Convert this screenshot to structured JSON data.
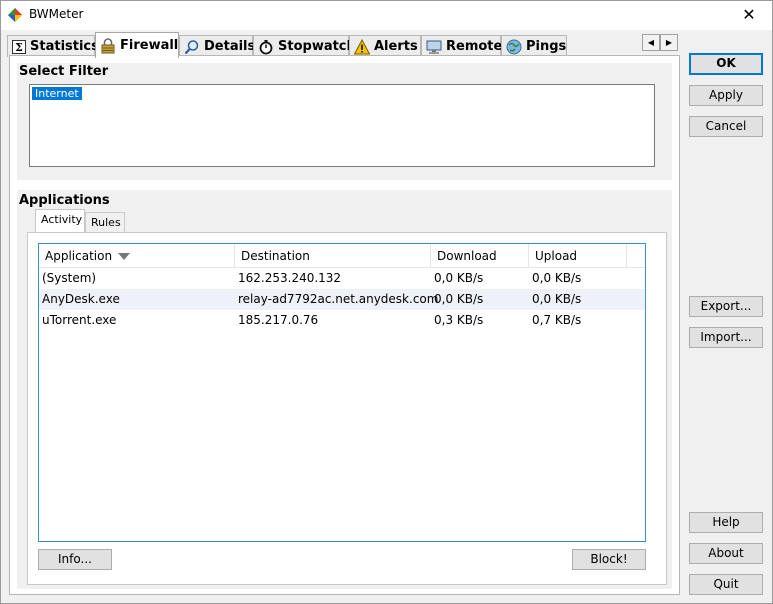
{
  "window": {
    "title": "BWMeter",
    "close_symbol": "✕",
    "app_icon": "bwmeter-logo-icon"
  },
  "tabs": [
    {
      "label": "Statistics",
      "icon": "sigma-icon"
    },
    {
      "label": "Firewall",
      "icon": "lock-icon",
      "active": true
    },
    {
      "label": "Details",
      "icon": "magnifier-icon"
    },
    {
      "label": "Stopwatch",
      "icon": "stopwatch-icon"
    },
    {
      "label": "Alerts",
      "icon": "warning-icon"
    },
    {
      "label": "Remote",
      "icon": "monitor-icon"
    },
    {
      "label": "Pings",
      "icon": "globe-icon"
    }
  ],
  "tab_scroll": {
    "left": "◀",
    "right": "▶"
  },
  "filter": {
    "title": "Select Filter",
    "items": [
      "Internet"
    ]
  },
  "applications": {
    "title": "Applications",
    "subtabs": [
      "Activity",
      "Rules"
    ],
    "columns": [
      "Application",
      "Destination",
      "Download",
      "Upload"
    ],
    "rows": [
      {
        "application": "(System)",
        "destination": "162.253.240.132",
        "download": "0,0 KB/s",
        "upload": "0,0 KB/s"
      },
      {
        "application": "AnyDesk.exe",
        "destination": "relay-ad7792ac.net.anydesk.com",
        "download": "0,0 KB/s",
        "upload": "0,0 KB/s"
      },
      {
        "application": "uTorrent.exe",
        "destination": "185.217.0.76",
        "download": "0,3 KB/s",
        "upload": "0,7 KB/s"
      }
    ],
    "info_button": "Info...",
    "block_button": "Block!"
  },
  "side_buttons": {
    "ok": "OK",
    "apply": "Apply",
    "cancel": "Cancel",
    "export": "Export...",
    "import": "Import...",
    "help": "Help",
    "about": "About",
    "quit": "Quit"
  },
  "colors": {
    "selection": "#0078d7",
    "focus_border": "#3a8ed8"
  }
}
